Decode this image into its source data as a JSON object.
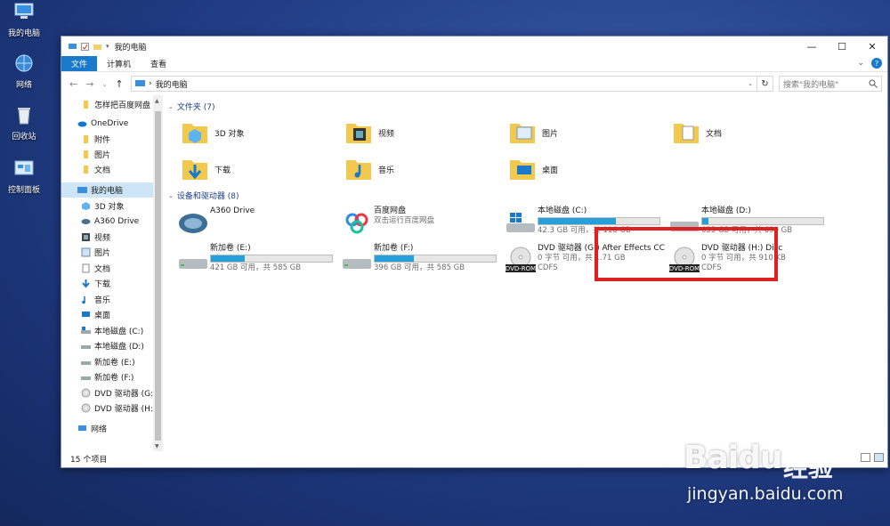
{
  "desktop": {
    "icons": [
      {
        "label": "我的电脑",
        "icon": "computer-icon"
      },
      {
        "label": "网络",
        "icon": "network-icon"
      },
      {
        "label": "回收站",
        "icon": "recycle-bin-icon"
      },
      {
        "label": "控制面板",
        "icon": "control-panel-icon"
      }
    ]
  },
  "window": {
    "title": "我的电脑",
    "controls": {
      "minimize": "—",
      "maximize": "☐",
      "close": "✕"
    },
    "ribbon_tabs": [
      "文件",
      "计算机",
      "查看"
    ],
    "address": {
      "path": "我的电脑",
      "separator": "›"
    },
    "search": {
      "placeholder": "搜索\"我的电脑\""
    },
    "nav_pane": [
      {
        "label": "怎样把百度网盘",
        "icon": "folder-icon"
      },
      {
        "label": "OneDrive",
        "icon": "onedrive-icon"
      },
      {
        "label": "附件",
        "icon": "folder-icon"
      },
      {
        "label": "图片",
        "icon": "folder-icon"
      },
      {
        "label": "文档",
        "icon": "folder-icon"
      },
      {
        "label": "我的电脑",
        "icon": "computer-icon"
      },
      {
        "label": "3D 对象",
        "icon": "3d-objects-icon"
      },
      {
        "label": "A360 Drive",
        "icon": "a360-icon"
      },
      {
        "label": "视频",
        "icon": "video-icon"
      },
      {
        "label": "图片",
        "icon": "pictures-icon"
      },
      {
        "label": "文档",
        "icon": "documents-icon"
      },
      {
        "label": "下载",
        "icon": "download-icon"
      },
      {
        "label": "音乐",
        "icon": "music-icon"
      },
      {
        "label": "桌面",
        "icon": "desktop-icon"
      },
      {
        "label": "本地磁盘 (C:)",
        "icon": "system-drive-icon"
      },
      {
        "label": "本地磁盘 (D:)",
        "icon": "drive-icon"
      },
      {
        "label": "新加卷 (E:)",
        "icon": "drive-icon"
      },
      {
        "label": "新加卷 (F:)",
        "icon": "drive-icon"
      },
      {
        "label": "DVD 驱动器 (G:)",
        "icon": "dvd-icon"
      },
      {
        "label": "DVD 驱动器 (H:)",
        "icon": "dvd-icon"
      },
      {
        "label": "网络",
        "icon": "network-icon"
      }
    ],
    "groups": {
      "folders": "文件夹 (7)",
      "devices": "设备和驱动器 (8)"
    },
    "folders": [
      {
        "label": "3D 对象",
        "icon": "3d-objects-folder-icon"
      },
      {
        "label": "视频",
        "icon": "video-folder-icon"
      },
      {
        "label": "图片",
        "icon": "pictures-folder-icon"
      },
      {
        "label": "文档",
        "icon": "documents-folder-icon"
      },
      {
        "label": "下载",
        "icon": "download-folder-icon"
      },
      {
        "label": "音乐",
        "icon": "music-folder-icon"
      },
      {
        "label": "桌面",
        "icon": "desktop-folder-icon"
      }
    ],
    "devices": [
      {
        "name": "A360 Drive",
        "sub": "",
        "icon": "a360-icon"
      },
      {
        "name": "百度网盘",
        "sub": "双击运行百度网盘",
        "icon": "baidu-netdisk-icon"
      },
      {
        "name": "本地磁盘 (C:)",
        "sub": "42.3 GB 可用，共 118 GB",
        "used_fraction": 0.64,
        "icon": "system-drive-icon"
      },
      {
        "name": "本地磁盘 (D:)",
        "sub": "655 GB 可用，共 690 GB",
        "used_fraction": 0.05,
        "icon": "drive-icon"
      },
      {
        "name": "新加卷 (E:)",
        "sub": "421 GB 可用，共 585 GB",
        "used_fraction": 0.28,
        "icon": "drive-icon"
      },
      {
        "name": "新加卷 (F:)",
        "sub": "396 GB 可用，共 585 GB",
        "used_fraction": 0.32,
        "icon": "drive-icon"
      },
      {
        "name": "DVD 驱动器 (G:) After Effects CC",
        "sub": "0 字节 可用，共 1.71 GB",
        "sub2": "CDFS",
        "icon": "dvd-rom-icon",
        "badge": "DVD-ROM"
      },
      {
        "name": "DVD 驱动器 (H:) Disc",
        "sub": "0 字节 可用，共 910 KB",
        "sub2": "CDFS",
        "icon": "dvd-rom-icon",
        "badge": "DVD-ROM"
      }
    ],
    "status": "15 个项目"
  },
  "watermark": {
    "brand": "Baidu",
    "brand_cn": "经验",
    "url": "jingyan.baidu.com"
  },
  "colors": {
    "accent": "#1979ca",
    "bar_fill": "#26a0da",
    "highlight": "#e02121",
    "selection": "#cde5f7"
  }
}
